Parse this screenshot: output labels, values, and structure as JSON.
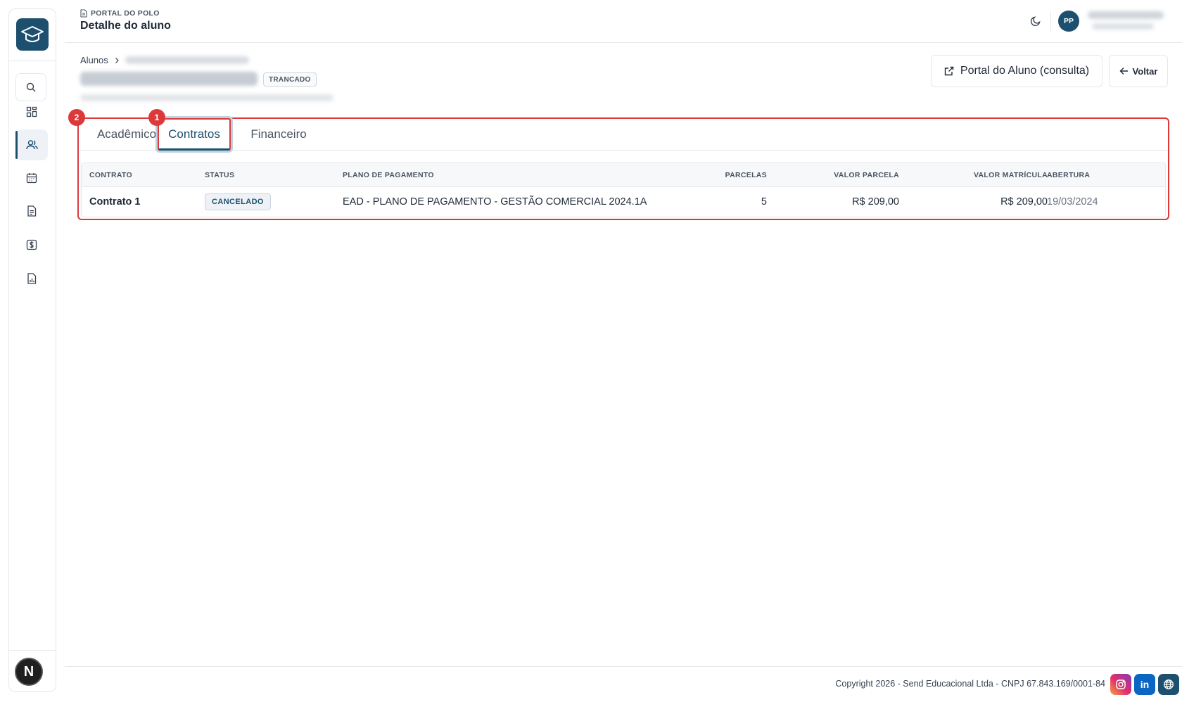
{
  "header": {
    "section_label": "PORTAL DO POLO",
    "page_title": "Detalhe do aluno",
    "avatar_initials": "PP"
  },
  "breadcrumb": {
    "root": "Alunos"
  },
  "student": {
    "status": "TRANCADO"
  },
  "actions": {
    "portal_label": "Portal do Aluno (consulta)",
    "back_label": "Voltar"
  },
  "markers": {
    "first": "1",
    "second": "2"
  },
  "tabs": [
    {
      "label": "Acadêmico",
      "active": false
    },
    {
      "label": "Contratos",
      "active": true
    },
    {
      "label": "Financeiro",
      "active": false
    }
  ],
  "table": {
    "headers": [
      "CONTRATO",
      "STATUS",
      "PLANO DE PAGAMENTO",
      "PARCELAS",
      "VALOR PARCELA",
      "VALOR MATRÍCULA",
      "ABERTURA"
    ],
    "rows": [
      {
        "contrato": "Contrato 1",
        "status": "CANCELADO",
        "plano": "EAD - PLANO DE PAGAMENTO - GESTÃO COMERCIAL 2024.1A",
        "parcelas": "5",
        "valor_parcela": "R$ 209,00",
        "valor_matricula": "R$ 209,00",
        "abertura": "19/03/2024"
      }
    ]
  },
  "footer": {
    "copyright": "Copyright 2026 - Send Educacional Ltda - CNPJ 67.843.169/0001-84",
    "linkedin_glyph": "in",
    "next_glyph": "N"
  },
  "icons": {
    "logo": "graduation-cap-icon",
    "nav": [
      "search-icon",
      "dashboard-icon",
      "users-icon",
      "calendar-icon",
      "document-icon",
      "dollar-icon",
      "report-icon"
    ],
    "theme": "moon-icon",
    "portal": "external-link-icon",
    "back": "arrow-left-icon",
    "social": [
      "instagram-icon",
      "linkedin-icon",
      "globe-icon"
    ]
  },
  "colors": {
    "brand": "#1d4f6e",
    "highlight": "#dc3a3a",
    "linkedin": "#0a66c2"
  }
}
